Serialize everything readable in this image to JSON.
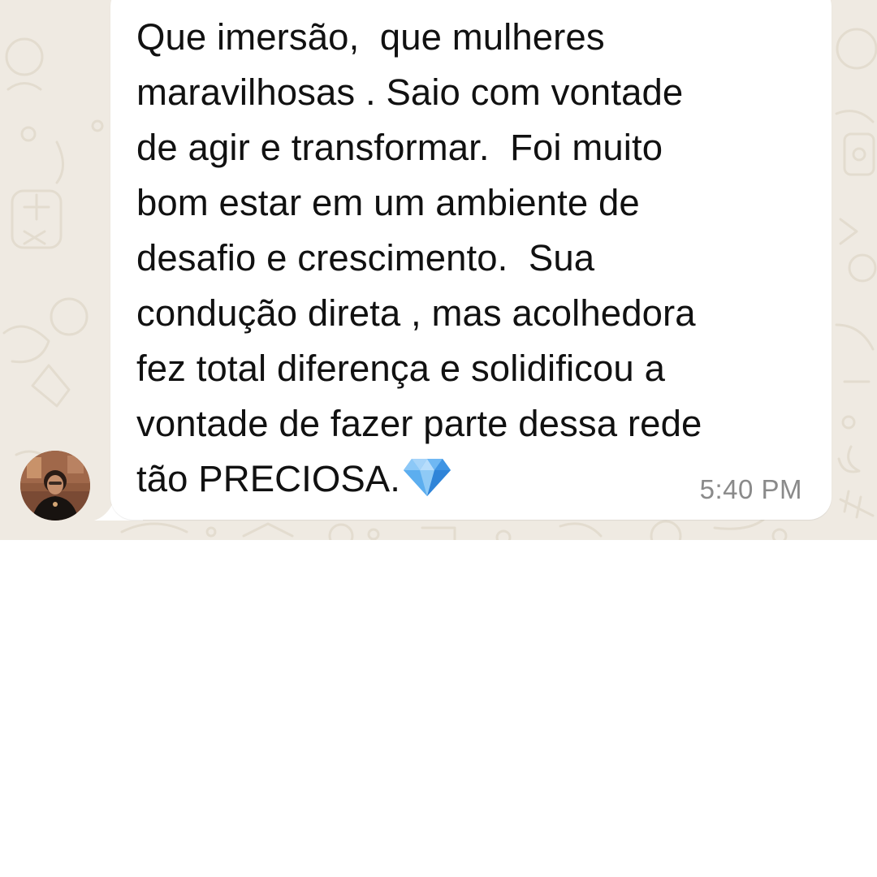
{
  "message": {
    "text": "Que imersão,  que mulheres maravilhosas . Saio com vontade de agir e transformar.  Foi muito bom estar em um ambiente de desafio e crescimento.  Sua condução direta , mas acolhedora fez total diferença e solidificou a vontade de fazer parte dessa rede tão PRECIOSA.",
    "lines": [
      "Que imersão,  que mulheres",
      "maravilhosas . Saio com vontade",
      "de agir e transformar.  Foi muito",
      "bom estar em um ambiente de",
      "desafio e crescimento.  Sua",
      "condução direta , mas acolhedora",
      "fez total diferença e solidificou a",
      "vontade de fazer parte dessa rede",
      "tão PRECIOSA."
    ],
    "emoji": "gem-stone-icon",
    "time": "5:40 PM"
  },
  "sender": {
    "avatar": "avatar-photo"
  },
  "colors": {
    "chat_background": "#efeae2",
    "bubble": "#ffffff",
    "text": "#111111",
    "timestamp": "#8a8a8a",
    "gem": "#5aa8f0"
  }
}
